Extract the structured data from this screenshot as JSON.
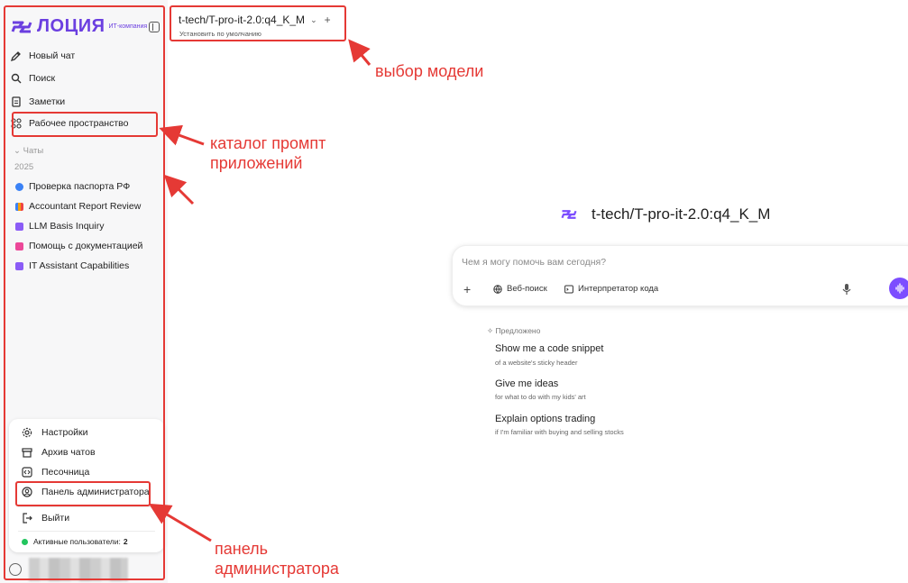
{
  "brand": {
    "name": "ЛОЦИЯ",
    "subtitle": "ИТ-компания",
    "color": "#6b3fe0"
  },
  "nav": [
    {
      "label": "Новый чат",
      "icon": "new-chat-icon"
    },
    {
      "label": "Поиск",
      "icon": "search-icon"
    },
    {
      "label": "Заметки",
      "icon": "notes-icon"
    },
    {
      "label": "Рабочее пространство",
      "icon": "workspace-icon"
    }
  ],
  "chats_section": {
    "label": "Чаты",
    "year": "2025"
  },
  "chats": [
    {
      "label": "Проверка паспорта РФ",
      "icon": "magnifier-emoji-icon",
      "color": "#3b82f6"
    },
    {
      "label": "Accountant Report Review",
      "icon": "chart-emoji-icon",
      "color": "#f59e0b"
    },
    {
      "label": "LLM Basis Inquiry",
      "icon": "robot-emoji-icon",
      "color": "#8b5cf6"
    },
    {
      "label": "Помощь с документацией",
      "icon": "document-emoji-icon",
      "color": "#ec4899"
    },
    {
      "label": "IT Assistant Capabilities",
      "icon": "robot-emoji-icon",
      "color": "#8b5cf6"
    }
  ],
  "user_menu": {
    "items": [
      {
        "label": "Настройки",
        "icon": "gear-icon"
      },
      {
        "label": "Архив чатов",
        "icon": "archive-icon"
      },
      {
        "label": "Песочница",
        "icon": "code-icon"
      },
      {
        "label": "Панель администратора",
        "icon": "admin-icon"
      },
      {
        "label": "Выйти",
        "icon": "logout-icon"
      }
    ],
    "active_users_label": "Активные пользователи:",
    "active_users_count": "2"
  },
  "model": {
    "name": "t-tech/T-pro-it-2.0:q4_K_M",
    "set_default": "Установить по умолчанию"
  },
  "hero": {
    "title": "t-tech/T-pro-it-2.0:q4_K_M"
  },
  "prompt": {
    "placeholder": "Чем я могу помочь вам сегодня?",
    "web_search": "Веб-поиск",
    "code_interpreter": "Интерпретатор кода"
  },
  "suggestions": {
    "label": "Предложено",
    "items": [
      {
        "title": "Show me a code snippet",
        "subtitle": "of a website's sticky header"
      },
      {
        "title": "Give me ideas",
        "subtitle": "for what to do with my kids' art"
      },
      {
        "title": "Explain options trading",
        "subtitle": "if I'm familiar with buying and selling stocks"
      }
    ]
  },
  "annotations": {
    "model_choice": "выбор модели",
    "catalog_line1": "каталог промпт",
    "catalog_line2": "приложений",
    "admin_line1": "панель",
    "admin_line2": "администратора",
    "color": "#e53935"
  }
}
